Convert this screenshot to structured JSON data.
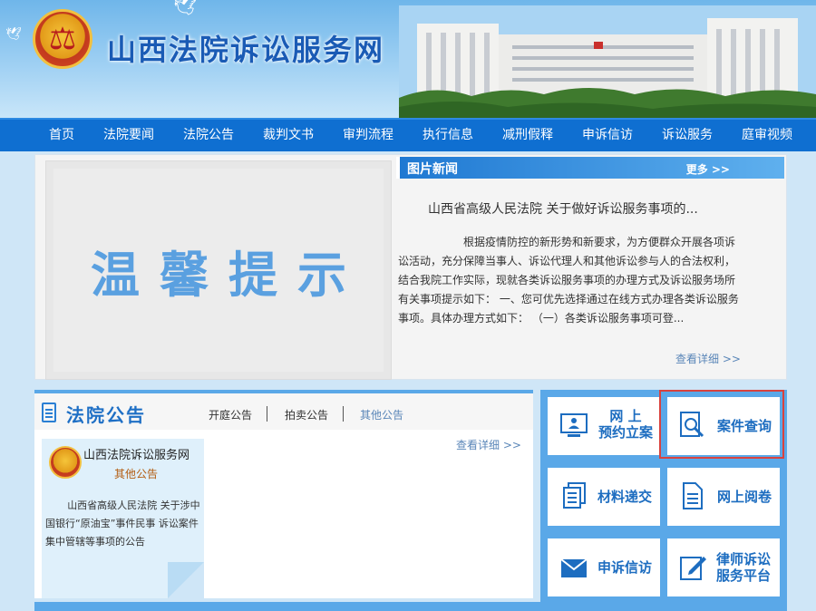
{
  "header": {
    "site_title": "山西法院诉讼服务网"
  },
  "nav": {
    "items": [
      "首页",
      "法院要闻",
      "法院公告",
      "裁判文书",
      "审判流程",
      "执行信息",
      "减刑假释",
      "申诉信访",
      "诉讼服务",
      "庭审视频"
    ]
  },
  "banner": {
    "notice_text": "温馨提示"
  },
  "picture_news": {
    "heading": "图片新闻",
    "more": "更多 >>",
    "title": "山西省高级人民法院 关于做好诉讼服务事项的...",
    "body": "根据疫情防控的新形势和新要求，为方便群众开展各项诉讼活动，充分保障当事人、诉讼代理人和其他诉讼参与人的合法权利，结合我院工作实际，现就各类诉讼服务事项的办理方式及诉讼服务场所有关事项提示如下： 一、您可优先选择通过在线方式办理各类诉讼服务事项。具体办理方式如下： （一）各类诉讼服务事项可登...",
    "detail_link": "查看详细 >>"
  },
  "court_notice": {
    "heading": "法院公告",
    "tabs": [
      "开庭公告",
      "拍卖公告",
      "其他公告"
    ],
    "more": "查看详细 >>",
    "card": {
      "source": "山西法院诉讼服务网",
      "category": "其他公告",
      "text": "山西省高级人民法院 关于涉中国银行“原油宝”事件民事 诉讼案件集中管辖等事项的公告"
    }
  },
  "services": {
    "online_filing_line1": "网 上",
    "online_filing_line2": "预约立案",
    "case_query": "案件查询",
    "material_submit": "材料递交",
    "online_review": "网上阅卷",
    "petition": "申诉信访",
    "lawyer_line1": "律师诉讼",
    "lawyer_line2": "服务平台"
  },
  "colors": {
    "accent": "#1d6dc0",
    "nav": "#0f6fd1",
    "highlight": "#d9423e"
  }
}
